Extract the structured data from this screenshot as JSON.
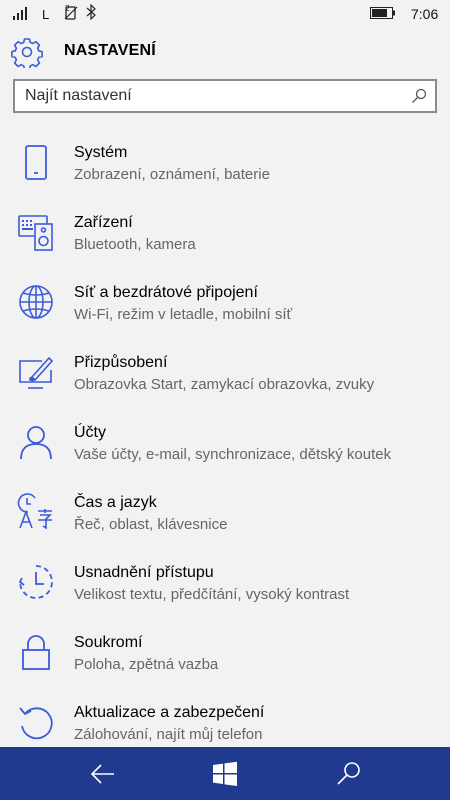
{
  "status_bar": {
    "carrier_letter": "L",
    "time": "7:06"
  },
  "header": {
    "title": "NASTAVENÍ",
    "icon": "gear-icon"
  },
  "search": {
    "placeholder": "Najít nastavení",
    "value": ""
  },
  "colors": {
    "accent": "#3b5bdb",
    "navbar": "#1f3a8e",
    "background": "#f2f2f2"
  },
  "items": [
    {
      "label": "Systém",
      "sub": "Zobrazení, oznámení, baterie",
      "icon": "phone-icon"
    },
    {
      "label": "Zařízení",
      "sub": "Bluetooth, kamera",
      "icon": "devices-icon"
    },
    {
      "label": "Síť a bezdrátové připojení",
      "sub": "Wi-Fi, režim v letadle, mobilní síť",
      "icon": "globe-icon"
    },
    {
      "label": "Přizpůsobení",
      "sub": "Obrazovka Start, zamykací obrazovka, zvuky",
      "icon": "personalization-icon"
    },
    {
      "label": "Účty",
      "sub": "Vaše účty, e-mail, synchronizace, dětský koutek",
      "icon": "person-icon"
    },
    {
      "label": "Čas a jazyk",
      "sub": "Řeč, oblast, klávesnice",
      "icon": "time-language-icon"
    },
    {
      "label": "Usnadnění přístupu",
      "sub": "Velikost textu, předčítání, vysoký kontrast",
      "icon": "ease-of-access-icon"
    },
    {
      "label": "Soukromí",
      "sub": "Poloha, zpětná vazba",
      "icon": "lock-icon"
    },
    {
      "label": "Aktualizace a zabezpečení",
      "sub": "Zálohování, najít můj telefon",
      "icon": "update-icon"
    }
  ],
  "navbar": {
    "back_icon": "back-arrow-icon",
    "home_icon": "windows-logo-icon",
    "search_icon": "search-icon"
  }
}
